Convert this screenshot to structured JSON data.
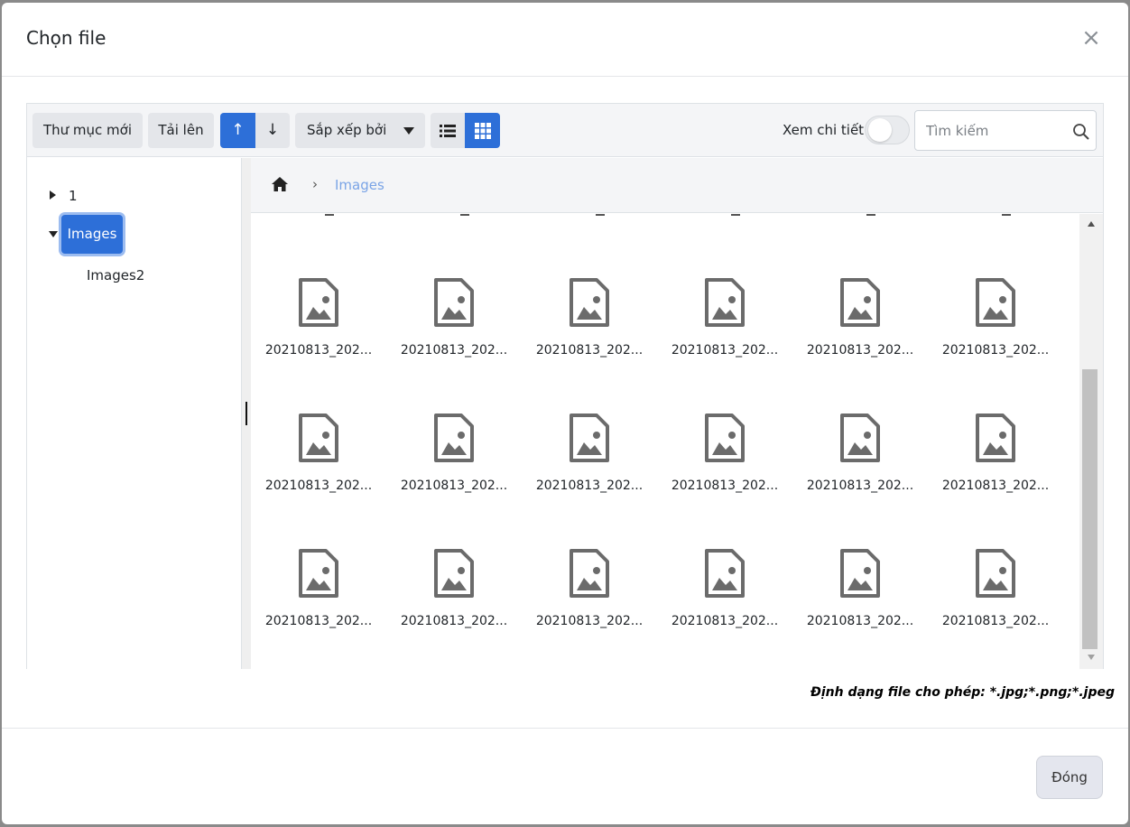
{
  "dialog": {
    "title": "Chọn file",
    "close_symbol": "×"
  },
  "toolbar": {
    "new_folder_label": "Thư mục mới",
    "upload_label": "Tải lên",
    "sort_asc_symbol": "↑",
    "sort_desc_symbol": "↓",
    "sort_by_label": "Sắp xếp bởi",
    "detail_label": "Xem chi tiết",
    "detail_toggle_on": false,
    "search_placeholder": "Tìm kiếm",
    "search_value": "",
    "active_view": "grid"
  },
  "tree": {
    "items": [
      {
        "label": "1",
        "expanded": false,
        "selected": false
      },
      {
        "label": "Images",
        "expanded": true,
        "selected": true
      },
      {
        "label": "Images2",
        "expanded": false,
        "selected": false
      }
    ]
  },
  "breadcrumb": {
    "separator": "›",
    "items": [
      {
        "label": "Images"
      }
    ]
  },
  "files": {
    "visible_names": [
      "20210813_202...",
      "20210813_202...",
      "20210813_202...",
      "20210813_202...",
      "20210813_202...",
      "20210813_202...",
      "20210813_202...",
      "20210813_202...",
      "20210813_202...",
      "20210813_202...",
      "20210813_202...",
      "20210813_202...",
      "20210813_202...",
      "20210813_202...",
      "20210813_202...",
      "20210813_202...",
      "20210813_202...",
      "20210813_202..."
    ],
    "icon": "image-file-icon",
    "icon_color": "#6b6b6b"
  },
  "hint": {
    "text": "Định dạng file cho phép: *.jpg;*.png;*.jpeg"
  },
  "footer": {
    "close_label": "Đóng"
  },
  "colors": {
    "accent": "#2d6fd8",
    "link": "#7aa4e6"
  }
}
